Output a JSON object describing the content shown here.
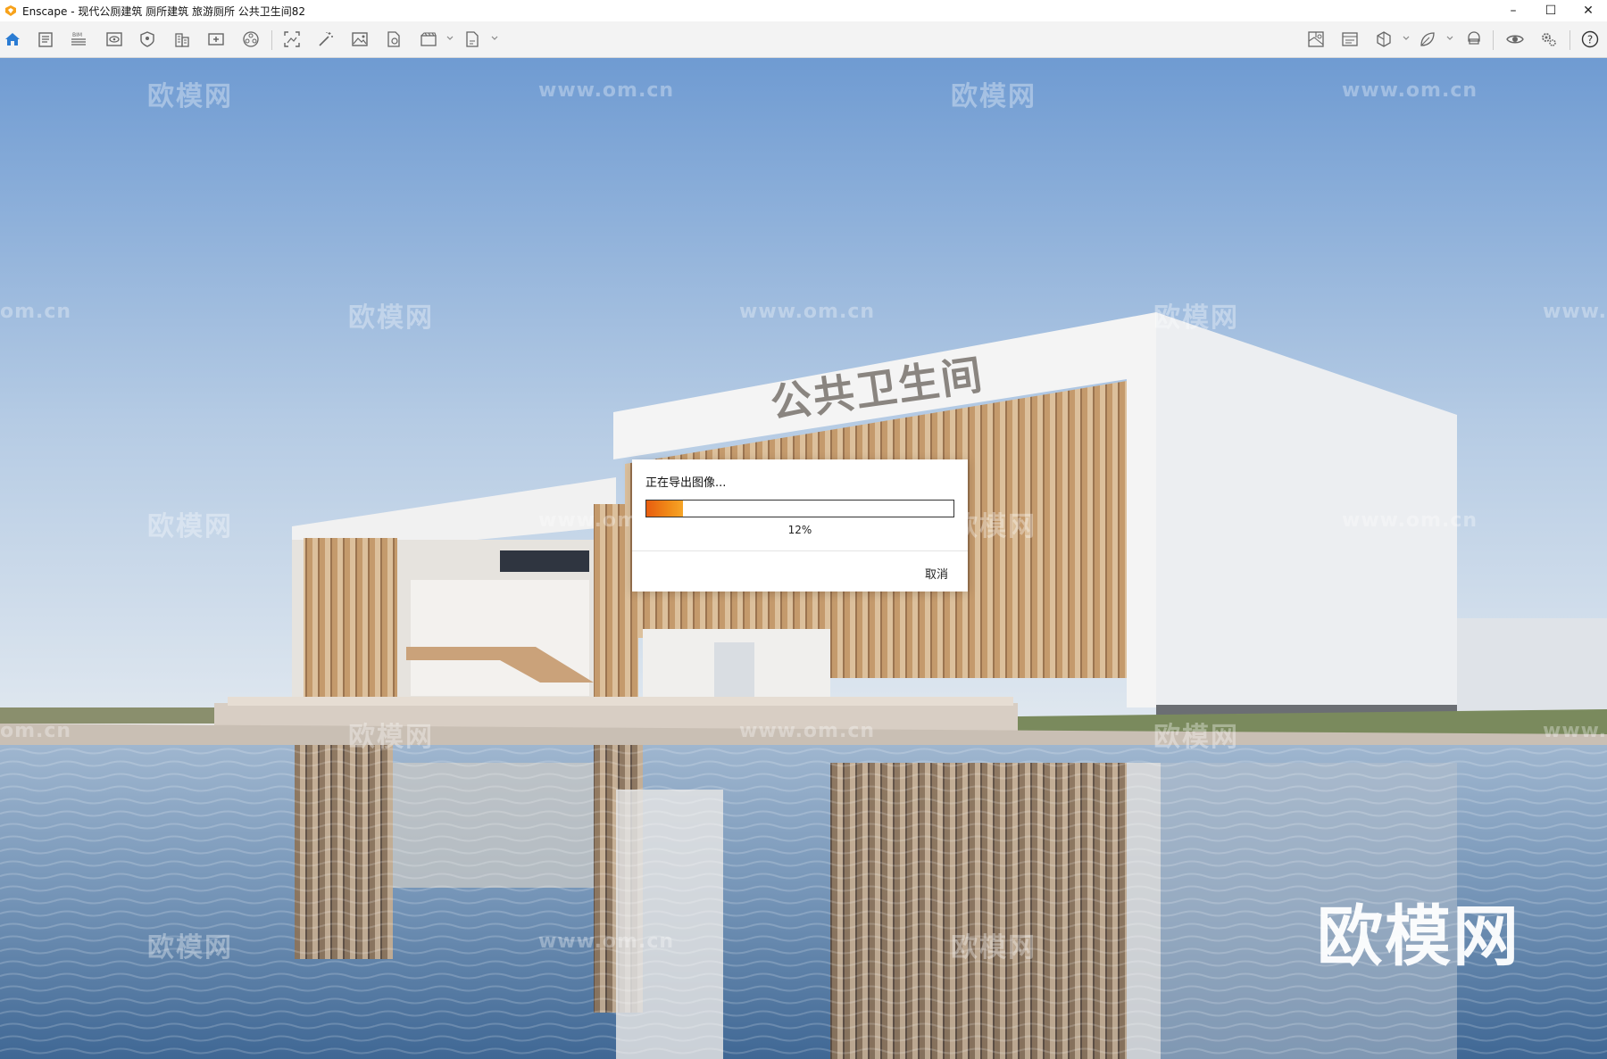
{
  "window": {
    "title": "Enscape - 现代公厕建筑 厕所建筑 旅游厕所 公共卫生间82",
    "controls": {
      "minimize": "–",
      "maximize": "☐",
      "close": "✕"
    }
  },
  "toolbar": {
    "left_icons": [
      "home-icon",
      "notes-icon",
      "bim-icon",
      "view-icon",
      "safe-frame-icon",
      "building-icon",
      "add-view-icon",
      "panorama-icon",
      "capture-area-icon",
      "magic-wand-icon",
      "image-icon",
      "file-settings-icon",
      "video-icon",
      "export-file-icon"
    ],
    "right_icons": [
      "map-icon",
      "render-settings-icon",
      "cube-icon",
      "leaf-icon",
      "vr-headset-icon",
      "eye-icon",
      "gears-icon",
      "help-icon"
    ],
    "bim_label": "BIM"
  },
  "viewport": {
    "sign_text": "公共卫生间",
    "watermark_cn": "欧模网",
    "watermark_url": "www.om.cn",
    "watermark_url_partial": "om.cn",
    "watermark_url_tail": "www."
  },
  "dialog": {
    "title": "正在导出图像...",
    "progress_fraction": 0.12,
    "progress_text": "12%",
    "cancel_label": "取消"
  },
  "colors": {
    "accent": "#2b7cd3",
    "progress_start": "#e85d10",
    "progress_end": "#f6a528"
  }
}
